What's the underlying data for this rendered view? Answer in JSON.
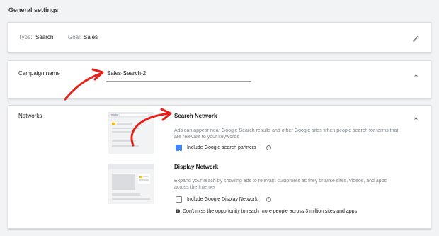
{
  "page": {
    "title": "General settings"
  },
  "summary": {
    "type_label": "Type:",
    "type_value": "Search",
    "goal_label": "Goal:",
    "goal_value": "Sales",
    "edit_icon": "pencil-icon"
  },
  "campaign_name": {
    "label": "Campaign name",
    "value": "Sales-Search-2",
    "collapse_icon": "chevron-up-icon"
  },
  "networks": {
    "label": "Networks",
    "collapse_icon": "chevron-up-icon",
    "search_network": {
      "title": "Search Network",
      "description": "Ads can appear near Google Search results and other Google sites when people search for terms that are relevant to your keywords",
      "checkbox_label": "Include Google search partners",
      "checked": true,
      "help_icon": "help-icon"
    },
    "display_network": {
      "title": "Display Network",
      "description": "Expand your reach by showing ads to relevant customers as they browse sites, videos, and apps across the Internet",
      "checkbox_label": "Include Google Display Network",
      "checked": false,
      "help_icon": "help-icon",
      "note": "Don't miss the opportunity to reach more people across 3 million sites and apps",
      "note_icon": "info-icon"
    }
  },
  "colors": {
    "accent_blue": "#4285f4",
    "annotation_red": "#e8201a",
    "thumbnail_yellow": "#fbbc04"
  }
}
